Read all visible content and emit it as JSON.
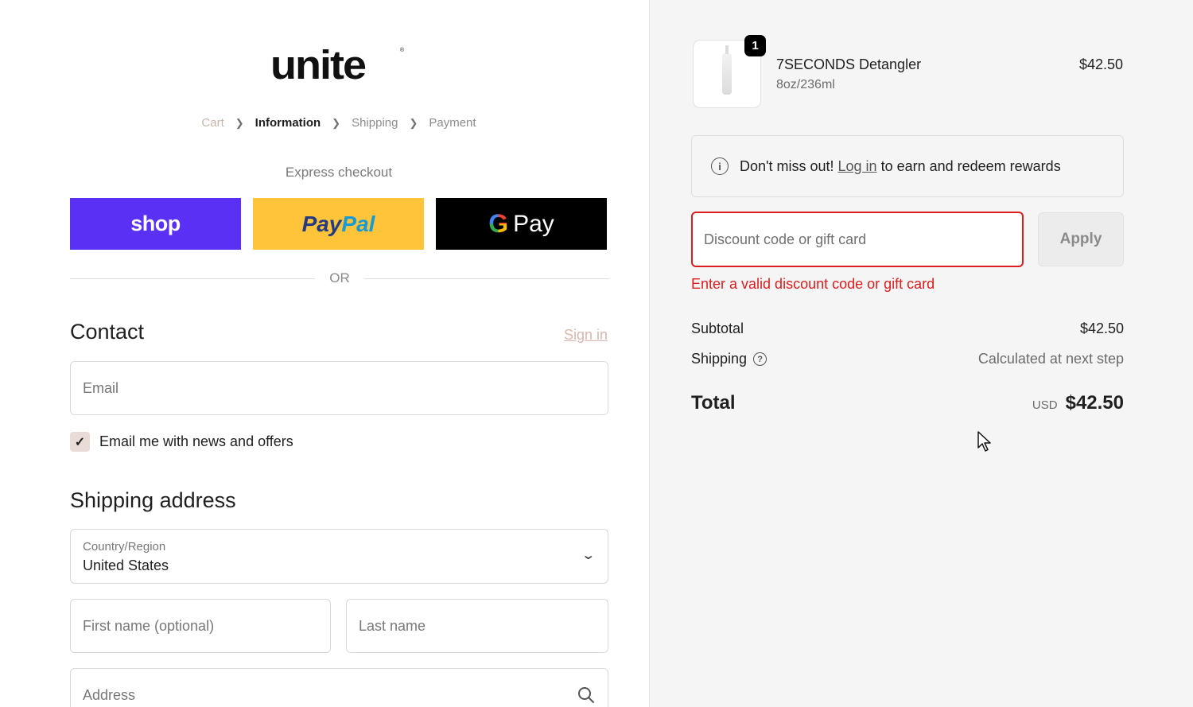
{
  "brand": {
    "logo": "unite",
    "registered": "®"
  },
  "breadcrumb": {
    "cart": "Cart",
    "information": "Information",
    "shipping": "Shipping",
    "payment": "Payment"
  },
  "express": {
    "title": "Express checkout",
    "shop_label": "shop",
    "paypal_label_1": "Pay",
    "paypal_label_2": "Pal",
    "gpay_g": "G",
    "gpay_label": "Pay",
    "or": "OR"
  },
  "contact": {
    "title": "Contact",
    "sign_in": "Sign in",
    "email_placeholder": "Email",
    "news_checkbox_label": "Email me with news and offers",
    "news_checked": true
  },
  "shipping_address": {
    "title": "Shipping address",
    "country_label": "Country/Region",
    "country_value": "United States",
    "first_name_placeholder": "First name (optional)",
    "last_name_placeholder": "Last name",
    "address_placeholder": "Address"
  },
  "order": {
    "item": {
      "quantity": "1",
      "name": "7SECONDS Detangler",
      "variant": "8oz/236ml",
      "price": "$42.50"
    },
    "rewards": {
      "prefix": "Don't miss out!",
      "link": "Log in",
      "suffix": "to earn and redeem rewards"
    },
    "discount": {
      "placeholder": "Discount code or gift card",
      "apply_label": "Apply",
      "error": "Enter a valid discount code or gift card"
    },
    "summary": {
      "subtotal_label": "Subtotal",
      "subtotal_value": "$42.50",
      "shipping_label": "Shipping",
      "shipping_value": "Calculated at next step",
      "total_label": "Total",
      "currency": "USD",
      "total_value": "$42.50"
    }
  },
  "colors": {
    "shop_pay": "#5a31f4",
    "paypal": "#ffc439",
    "gpay": "#000000",
    "error": "#dd1d1d",
    "sidebar_bg": "#f5f5f5"
  }
}
